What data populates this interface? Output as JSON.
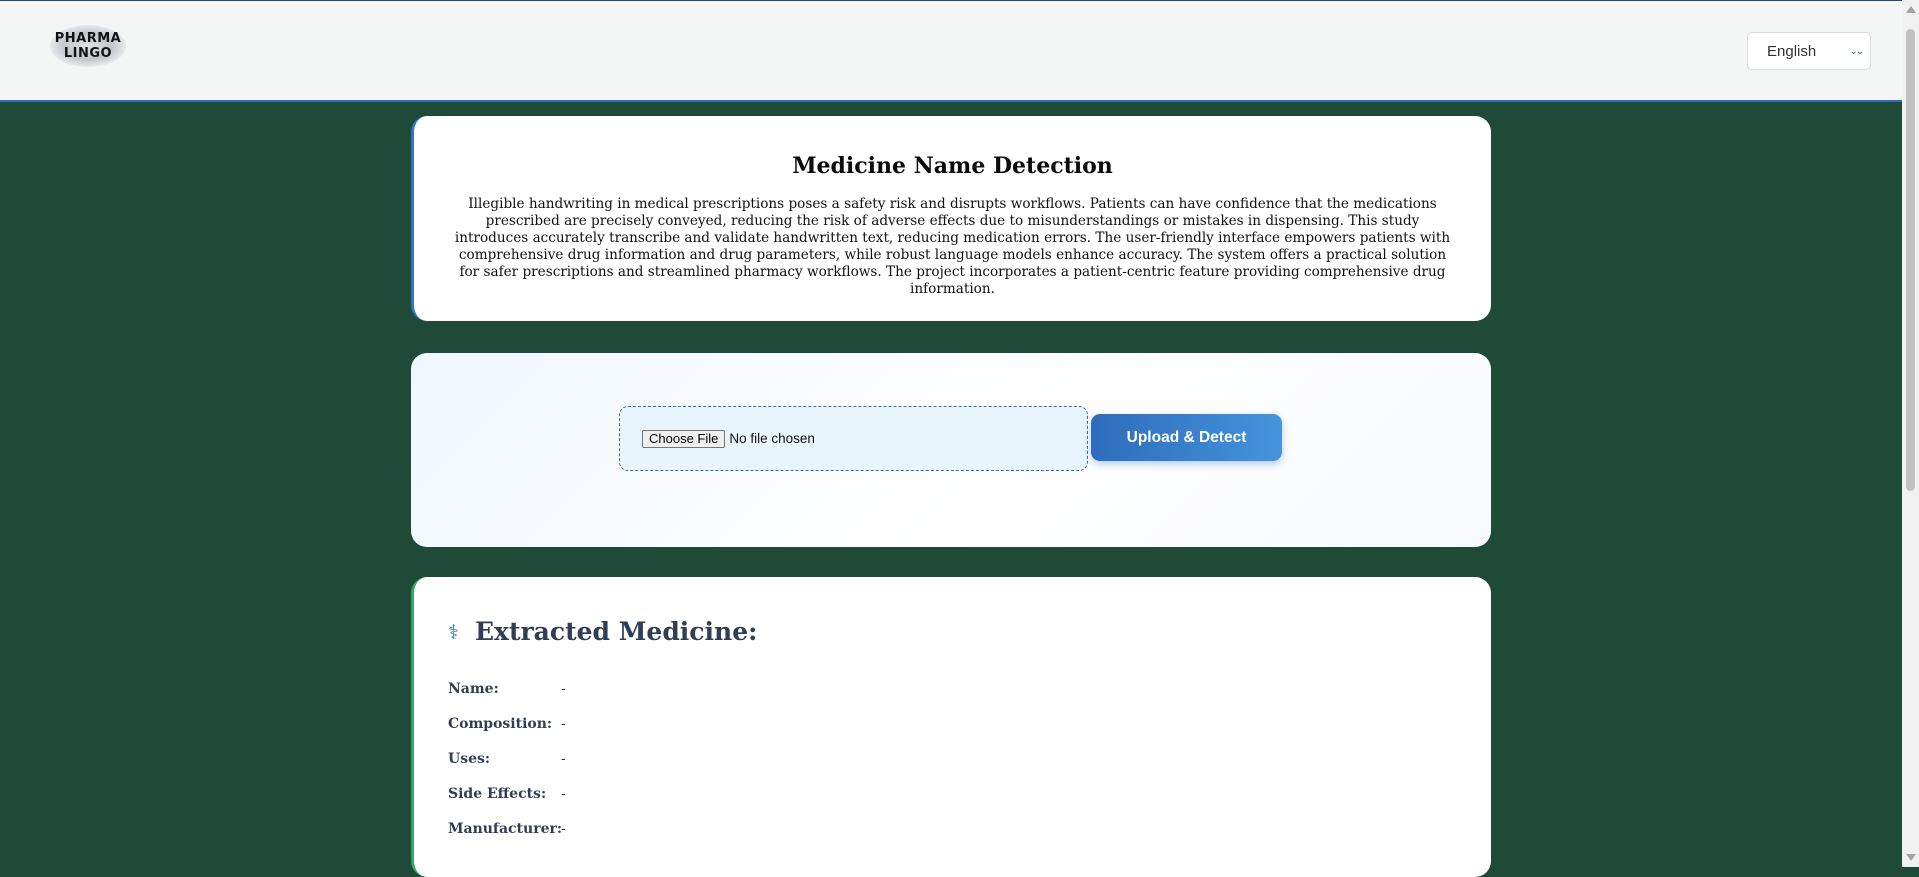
{
  "header": {
    "logo_line1": "PHARMA",
    "logo_line2": "LINGO",
    "language_selected": "English"
  },
  "about": {
    "title": "Medicine Name Detection",
    "description": "Illegible handwriting in medical prescriptions poses a safety risk and disrupts workflows. Patients can have confidence that the medications prescribed are precisely conveyed, reducing the risk of adverse effects due to misunderstandings or mistakes in dispensing. This study introduces accurately transcribe and validate handwritten text, reducing medication errors. The user-friendly interface empowers patients with comprehensive drug information and drug parameters, while robust language models enhance accuracy. The system offers a practical solution for safer prescriptions and streamlined pharmacy workflows. The project incorporates a patient-centric feature providing comprehensive drug information."
  },
  "upload": {
    "choose_file_label": "Choose File",
    "file_status": "No file chosen",
    "submit_label": "Upload & Detect"
  },
  "result": {
    "icon": "caduceus-icon",
    "title": "Extracted Medicine:",
    "fields": [
      {
        "label": "Name:",
        "value": "-"
      },
      {
        "label": "Composition:",
        "value": "-"
      },
      {
        "label": "Uses:",
        "value": "-"
      },
      {
        "label": "Side Effects:",
        "value": "-"
      },
      {
        "label": "Manufacturer:",
        "value": "-"
      }
    ]
  },
  "colors": {
    "page_background": "#1e4a37",
    "accent_blue": "#2d6fbf",
    "accent_green": "#2fa965"
  }
}
